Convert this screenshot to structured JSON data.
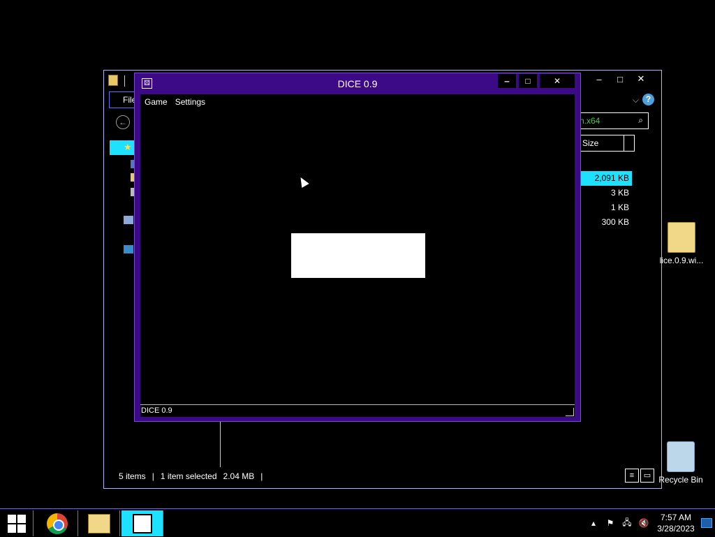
{
  "explorer": {
    "file_tab": "File",
    "search_query": "n.x64",
    "size_header": "Size",
    "sizes": [
      "2,091 KB",
      "3 KB",
      "1 KB",
      "300 KB"
    ],
    "status": {
      "items": "5 items",
      "selected": "1 item selected",
      "size": "2.04 MB"
    }
  },
  "dice": {
    "title": "DICE 0.9",
    "menu": [
      "Game",
      "Settings"
    ],
    "status": "DICE 0.9"
  },
  "desktop_icons": {
    "folder_label": "lice.0.9.wi...",
    "recycle_bin_label": "Recycle Bin"
  },
  "taskbar": {
    "time": "7:57 AM",
    "date": "3/28/2023"
  },
  "colors": {
    "dice_frame": "#3d0a87",
    "accent_selection": "#1ee0ff",
    "explorer_border": "#b3b3ff"
  }
}
